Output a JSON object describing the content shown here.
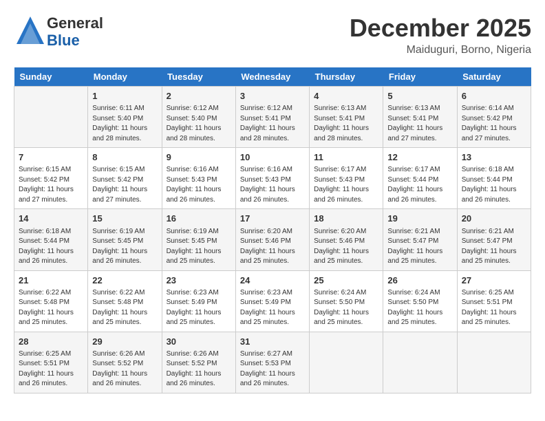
{
  "logo": {
    "general": "General",
    "blue": "Blue"
  },
  "title": "December 2025",
  "location": "Maiduguri, Borno, Nigeria",
  "days_of_week": [
    "Sunday",
    "Monday",
    "Tuesday",
    "Wednesday",
    "Thursday",
    "Friday",
    "Saturday"
  ],
  "weeks": [
    [
      {
        "day": "",
        "info": ""
      },
      {
        "day": "1",
        "info": "Sunrise: 6:11 AM\nSunset: 5:40 PM\nDaylight: 11 hours\nand 28 minutes."
      },
      {
        "day": "2",
        "info": "Sunrise: 6:12 AM\nSunset: 5:40 PM\nDaylight: 11 hours\nand 28 minutes."
      },
      {
        "day": "3",
        "info": "Sunrise: 6:12 AM\nSunset: 5:41 PM\nDaylight: 11 hours\nand 28 minutes."
      },
      {
        "day": "4",
        "info": "Sunrise: 6:13 AM\nSunset: 5:41 PM\nDaylight: 11 hours\nand 28 minutes."
      },
      {
        "day": "5",
        "info": "Sunrise: 6:13 AM\nSunset: 5:41 PM\nDaylight: 11 hours\nand 27 minutes."
      },
      {
        "day": "6",
        "info": "Sunrise: 6:14 AM\nSunset: 5:42 PM\nDaylight: 11 hours\nand 27 minutes."
      }
    ],
    [
      {
        "day": "7",
        "info": "Sunrise: 6:15 AM\nSunset: 5:42 PM\nDaylight: 11 hours\nand 27 minutes."
      },
      {
        "day": "8",
        "info": "Sunrise: 6:15 AM\nSunset: 5:42 PM\nDaylight: 11 hours\nand 27 minutes."
      },
      {
        "day": "9",
        "info": "Sunrise: 6:16 AM\nSunset: 5:43 PM\nDaylight: 11 hours\nand 26 minutes."
      },
      {
        "day": "10",
        "info": "Sunrise: 6:16 AM\nSunset: 5:43 PM\nDaylight: 11 hours\nand 26 minutes."
      },
      {
        "day": "11",
        "info": "Sunrise: 6:17 AM\nSunset: 5:43 PM\nDaylight: 11 hours\nand 26 minutes."
      },
      {
        "day": "12",
        "info": "Sunrise: 6:17 AM\nSunset: 5:44 PM\nDaylight: 11 hours\nand 26 minutes."
      },
      {
        "day": "13",
        "info": "Sunrise: 6:18 AM\nSunset: 5:44 PM\nDaylight: 11 hours\nand 26 minutes."
      }
    ],
    [
      {
        "day": "14",
        "info": "Sunrise: 6:18 AM\nSunset: 5:44 PM\nDaylight: 11 hours\nand 26 minutes."
      },
      {
        "day": "15",
        "info": "Sunrise: 6:19 AM\nSunset: 5:45 PM\nDaylight: 11 hours\nand 26 minutes."
      },
      {
        "day": "16",
        "info": "Sunrise: 6:19 AM\nSunset: 5:45 PM\nDaylight: 11 hours\nand 25 minutes."
      },
      {
        "day": "17",
        "info": "Sunrise: 6:20 AM\nSunset: 5:46 PM\nDaylight: 11 hours\nand 25 minutes."
      },
      {
        "day": "18",
        "info": "Sunrise: 6:20 AM\nSunset: 5:46 PM\nDaylight: 11 hours\nand 25 minutes."
      },
      {
        "day": "19",
        "info": "Sunrise: 6:21 AM\nSunset: 5:47 PM\nDaylight: 11 hours\nand 25 minutes."
      },
      {
        "day": "20",
        "info": "Sunrise: 6:21 AM\nSunset: 5:47 PM\nDaylight: 11 hours\nand 25 minutes."
      }
    ],
    [
      {
        "day": "21",
        "info": "Sunrise: 6:22 AM\nSunset: 5:48 PM\nDaylight: 11 hours\nand 25 minutes."
      },
      {
        "day": "22",
        "info": "Sunrise: 6:22 AM\nSunset: 5:48 PM\nDaylight: 11 hours\nand 25 minutes."
      },
      {
        "day": "23",
        "info": "Sunrise: 6:23 AM\nSunset: 5:49 PM\nDaylight: 11 hours\nand 25 minutes."
      },
      {
        "day": "24",
        "info": "Sunrise: 6:23 AM\nSunset: 5:49 PM\nDaylight: 11 hours\nand 25 minutes."
      },
      {
        "day": "25",
        "info": "Sunrise: 6:24 AM\nSunset: 5:50 PM\nDaylight: 11 hours\nand 25 minutes."
      },
      {
        "day": "26",
        "info": "Sunrise: 6:24 AM\nSunset: 5:50 PM\nDaylight: 11 hours\nand 25 minutes."
      },
      {
        "day": "27",
        "info": "Sunrise: 6:25 AM\nSunset: 5:51 PM\nDaylight: 11 hours\nand 25 minutes."
      }
    ],
    [
      {
        "day": "28",
        "info": "Sunrise: 6:25 AM\nSunset: 5:51 PM\nDaylight: 11 hours\nand 26 minutes."
      },
      {
        "day": "29",
        "info": "Sunrise: 6:26 AM\nSunset: 5:52 PM\nDaylight: 11 hours\nand 26 minutes."
      },
      {
        "day": "30",
        "info": "Sunrise: 6:26 AM\nSunset: 5:52 PM\nDaylight: 11 hours\nand 26 minutes."
      },
      {
        "day": "31",
        "info": "Sunrise: 6:27 AM\nSunset: 5:53 PM\nDaylight: 11 hours\nand 26 minutes."
      },
      {
        "day": "",
        "info": ""
      },
      {
        "day": "",
        "info": ""
      },
      {
        "day": "",
        "info": ""
      }
    ]
  ]
}
